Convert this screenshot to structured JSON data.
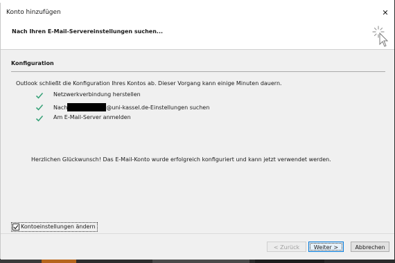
{
  "window": {
    "title": "Konto hinzufügen",
    "close_glyph": "✕"
  },
  "header": {
    "title": "Nach Ihren E-Mail-Servereinstellungen suchen..."
  },
  "config": {
    "section_title": "Konfiguration",
    "intro": "Outlook schließt die Konfiguration Ihres Kontos ab. Dieser Vorgang kann einige Minuten dauern.",
    "steps": [
      {
        "label": "Netzwerkverbindung herstellen",
        "status": "done"
      },
      {
        "label_prefix": "Nach",
        "label_suffix": "@uni-kassel.de-Einstellungen suchen",
        "status": "done",
        "redacted": true
      },
      {
        "label": "Am E-Mail-Server anmelden",
        "status": "done"
      }
    ],
    "success_message": "Herzlichen Glückwunsch! Das E-Mail-Konto wurde erfolgreich konfiguriert und kann jetzt verwendet werden."
  },
  "options": {
    "change_settings_label": "Kontoeinstellungen ändern",
    "change_settings_checked": true
  },
  "footer": {
    "back_label": "< Zurück",
    "next_label": "Weiter >",
    "cancel_label": "Abbrechen"
  },
  "colors": {
    "check": "#3aa37a",
    "accent": "#0078d7"
  },
  "icons": {
    "header": "spinner-icon",
    "step": "check-icon",
    "close": "close-icon"
  }
}
